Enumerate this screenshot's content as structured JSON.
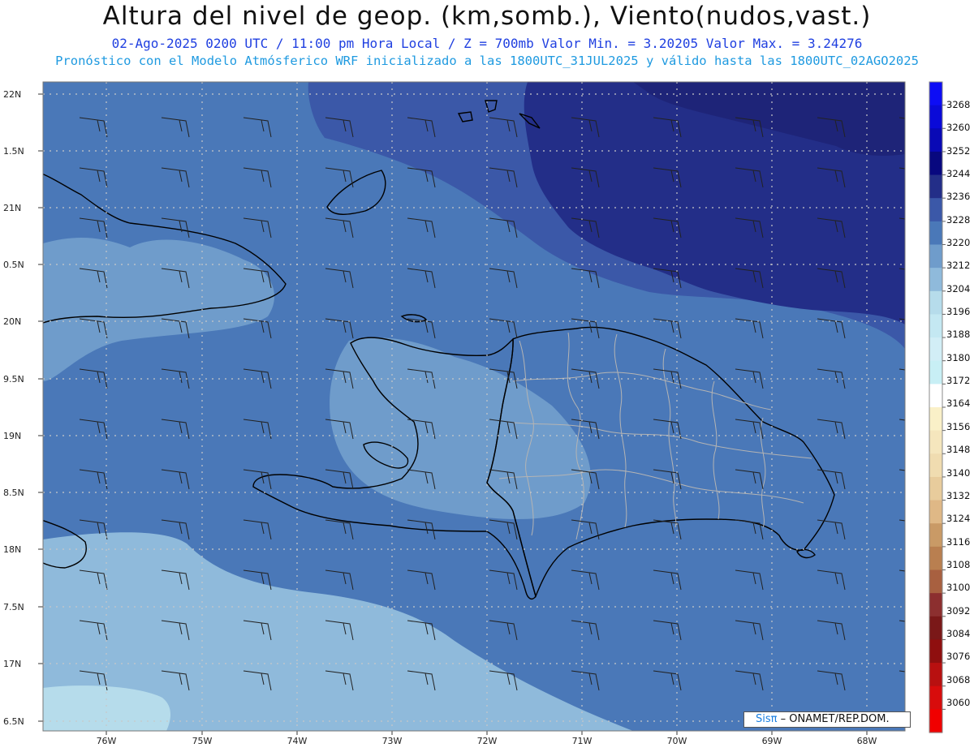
{
  "header": {
    "title": "Altura del nivel de geop. (km,somb.), Viento(nudos,vast.)",
    "subtitle": "02-Ago-2025  0200 UTC / 11:00 pm Hora Local / Z = 700mb   Valor Min. = 3.20205  Valor Max. = 3.24276",
    "model_line": "Pronóstico con el Modelo Atmósferico WRF inicializado a las 1800UTC_31JUL2025 y válido hasta las  1800UTC_02AGO2025"
  },
  "map": {
    "latitude_labels": [
      "22N",
      "1.5N",
      "21N",
      "0.5N",
      "20N",
      "9.5N",
      "19N",
      "8.5N",
      "18N",
      "7.5N",
      "17N",
      "6.5N"
    ],
    "longitude_labels": [
      "76W",
      "75W",
      "74W",
      "73W",
      "72W",
      "71W",
      "70W",
      "69W",
      "68W"
    ],
    "fill_colors": {
      "deep": "#232e88",
      "dark": "#3b58a8",
      "mid": "#4a78b8",
      "light": "#6f9ccb",
      "pale": "#8fbadb",
      "paler": "#b6dceb"
    },
    "coastline_color": "#000000",
    "province_border_color": "#b4b4b4",
    "wind_barb_color": "#222222",
    "grid_color": "#c8c8c8"
  },
  "colorbar": {
    "labels": [
      "3268",
      "3260",
      "3252",
      "3244",
      "3236",
      "3228",
      "3220",
      "3212",
      "3204",
      "3196",
      "3188",
      "3180",
      "3172",
      "3164",
      "3156",
      "3148",
      "3140",
      "3132",
      "3124",
      "3116",
      "3108",
      "3100",
      "3092",
      "3084",
      "3076",
      "3068",
      "3060"
    ],
    "colors": [
      "#0d0df5",
      "#0a0ad8",
      "#0909b5",
      "#08087f",
      "#232e88",
      "#3b58a8",
      "#4a78b8",
      "#6f9ccb",
      "#8fbadb",
      "#b6dceb",
      "#c4e8f2",
      "#d2eef6",
      "#c8eff5",
      "#ffffff",
      "#faf0c8",
      "#f5e6bd",
      "#f0dcb0",
      "#e8cc9c",
      "#dfb886",
      "#c99a66",
      "#b97f50",
      "#a86040",
      "#8c2f2f",
      "#7a1818",
      "#8f0f0f",
      "#b81010",
      "#d80c0c",
      "#f00000"
    ]
  },
  "credit": {
    "sis": "Sisπ",
    "rest": "– ONAMET/REP.DOM."
  }
}
